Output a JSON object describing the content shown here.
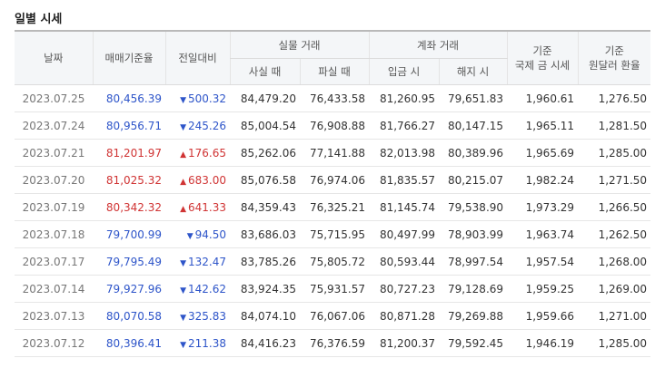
{
  "title": "일별 시세",
  "header": {
    "date": "날짜",
    "base_rate": "매매기준율",
    "change": "전일대비",
    "physical": "실물 거래",
    "buy": "사실 때",
    "sell": "파실 때",
    "account": "계좌 거래",
    "deposit": "입금 시",
    "withdraw": "해지 시",
    "intl_price_l1": "기준",
    "intl_price_l2": "국제 금 시세",
    "fx_rate_l1": "기준",
    "fx_rate_l2": "원달러 환율"
  },
  "rows": [
    {
      "date": "2023.07.25",
      "base": "80,456.39",
      "dir": "down",
      "arrow": "▼",
      "change": "500.32",
      "buy": "84,479.20",
      "sell": "76,433.58",
      "deposit": "81,260.95",
      "withdraw": "79,651.83",
      "intl": "1,960.61",
      "fx": "1,276.50"
    },
    {
      "date": "2023.07.24",
      "base": "80,956.71",
      "dir": "down",
      "arrow": "▼",
      "change": "245.26",
      "buy": "85,004.54",
      "sell": "76,908.88",
      "deposit": "81,766.27",
      "withdraw": "80,147.15",
      "intl": "1,965.11",
      "fx": "1,281.50"
    },
    {
      "date": "2023.07.21",
      "base": "81,201.97",
      "dir": "up",
      "arrow": "▲",
      "change": "176.65",
      "buy": "85,262.06",
      "sell": "77,141.88",
      "deposit": "82,013.98",
      "withdraw": "80,389.96",
      "intl": "1,965.69",
      "fx": "1,285.00"
    },
    {
      "date": "2023.07.20",
      "base": "81,025.32",
      "dir": "up",
      "arrow": "▲",
      "change": "683.00",
      "buy": "85,076.58",
      "sell": "76,974.06",
      "deposit": "81,835.57",
      "withdraw": "80,215.07",
      "intl": "1,982.24",
      "fx": "1,271.50"
    },
    {
      "date": "2023.07.19",
      "base": "80,342.32",
      "dir": "up",
      "arrow": "▲",
      "change": "641.33",
      "buy": "84,359.43",
      "sell": "76,325.21",
      "deposit": "81,145.74",
      "withdraw": "79,538.90",
      "intl": "1,973.29",
      "fx": "1,266.50"
    },
    {
      "date": "2023.07.18",
      "base": "79,700.99",
      "dir": "down",
      "arrow": "▼",
      "change": "94.50",
      "buy": "83,686.03",
      "sell": "75,715.95",
      "deposit": "80,497.99",
      "withdraw": "78,903.99",
      "intl": "1,963.74",
      "fx": "1,262.50"
    },
    {
      "date": "2023.07.17",
      "base": "79,795.49",
      "dir": "down",
      "arrow": "▼",
      "change": "132.47",
      "buy": "83,785.26",
      "sell": "75,805.72",
      "deposit": "80,593.44",
      "withdraw": "78,997.54",
      "intl": "1,957.54",
      "fx": "1,268.00"
    },
    {
      "date": "2023.07.14",
      "base": "79,927.96",
      "dir": "down",
      "arrow": "▼",
      "change": "142.62",
      "buy": "83,924.35",
      "sell": "75,931.57",
      "deposit": "80,727.23",
      "withdraw": "79,128.69",
      "intl": "1,959.25",
      "fx": "1,269.00"
    },
    {
      "date": "2023.07.13",
      "base": "80,070.58",
      "dir": "down",
      "arrow": "▼",
      "change": "325.83",
      "buy": "84,074.10",
      "sell": "76,067.06",
      "deposit": "80,871.28",
      "withdraw": "79,269.88",
      "intl": "1,959.66",
      "fx": "1,271.00"
    },
    {
      "date": "2023.07.12",
      "base": "80,396.41",
      "dir": "down",
      "arrow": "▼",
      "change": "211.38",
      "buy": "84,416.23",
      "sell": "76,376.59",
      "deposit": "81,200.37",
      "withdraw": "79,592.45",
      "intl": "1,946.19",
      "fx": "1,285.00"
    }
  ],
  "colors": {
    "down": "#2e55c9",
    "up": "#d03434"
  }
}
